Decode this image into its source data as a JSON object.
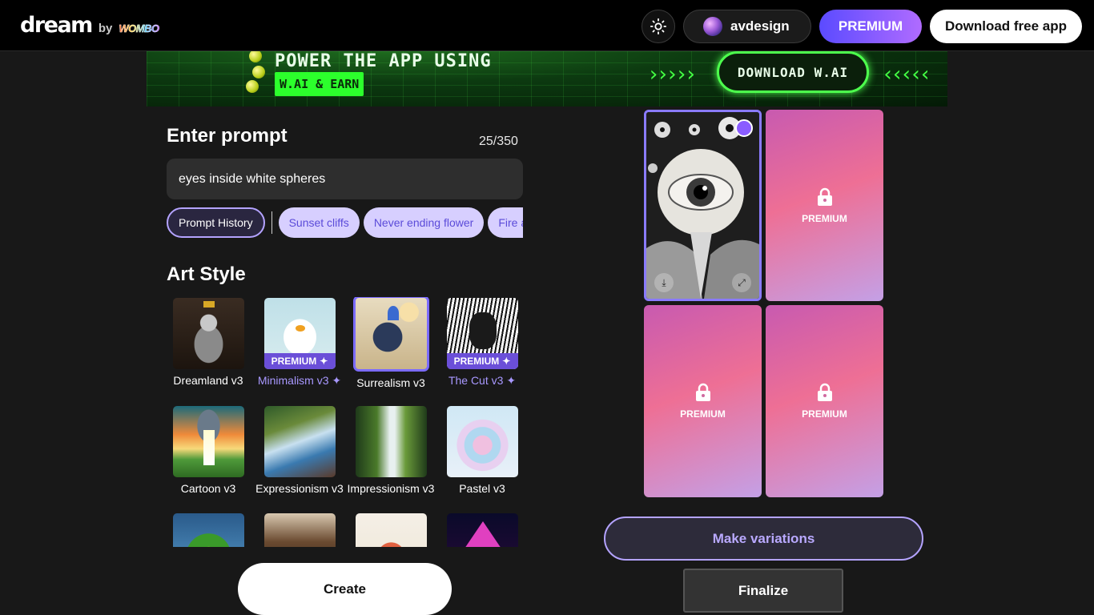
{
  "header": {
    "logo_word": "dream",
    "logo_by": "by",
    "logo_brand": "WOMBO",
    "theme_icon": "sun-icon",
    "username": "avdesign",
    "premium_label": "PREMIUM",
    "download_label": "Download free app"
  },
  "banner": {
    "headline": "POWER THE APP USING",
    "tag": "W.AI & EARN",
    "cta": "DOWNLOAD W.AI",
    "arrows_left": "›››››",
    "arrows_right": "‹‹‹‹‹",
    "accent": "#44ff44"
  },
  "prompt": {
    "heading": "Enter prompt",
    "counter": "25/350",
    "value": "eyes inside white spheres",
    "history_label": "Prompt History",
    "suggestions": [
      "Sunset cliffs",
      "Never ending flower",
      "Fire and w"
    ]
  },
  "art_style": {
    "heading": "Art Style",
    "premium_badge": "PREMIUM",
    "premium_star": "✦",
    "items": [
      {
        "name": "Dreamland v3",
        "premium": false,
        "selected": false
      },
      {
        "name": "Minimalism v3",
        "premium": true,
        "selected": false
      },
      {
        "name": "Surrealism v3",
        "premium": false,
        "selected": true
      },
      {
        "name": "The Cut v3",
        "premium": true,
        "selected": false
      },
      {
        "name": "Cartoon v3",
        "premium": false,
        "selected": false
      },
      {
        "name": "Expressionism v3",
        "premium": false,
        "selected": false
      },
      {
        "name": "Impressionism v3",
        "premium": false,
        "selected": false
      },
      {
        "name": "Pastel v3",
        "premium": false,
        "selected": false
      }
    ]
  },
  "create_label": "Create",
  "results": {
    "locked_label": "PREMIUM",
    "make_variations": "Make variations",
    "finalize": "Finalize"
  },
  "colors": {
    "accent": "#7b6bff",
    "premium_gradient_start": "#5b4bff",
    "premium_gradient_end": "#b06bff"
  }
}
